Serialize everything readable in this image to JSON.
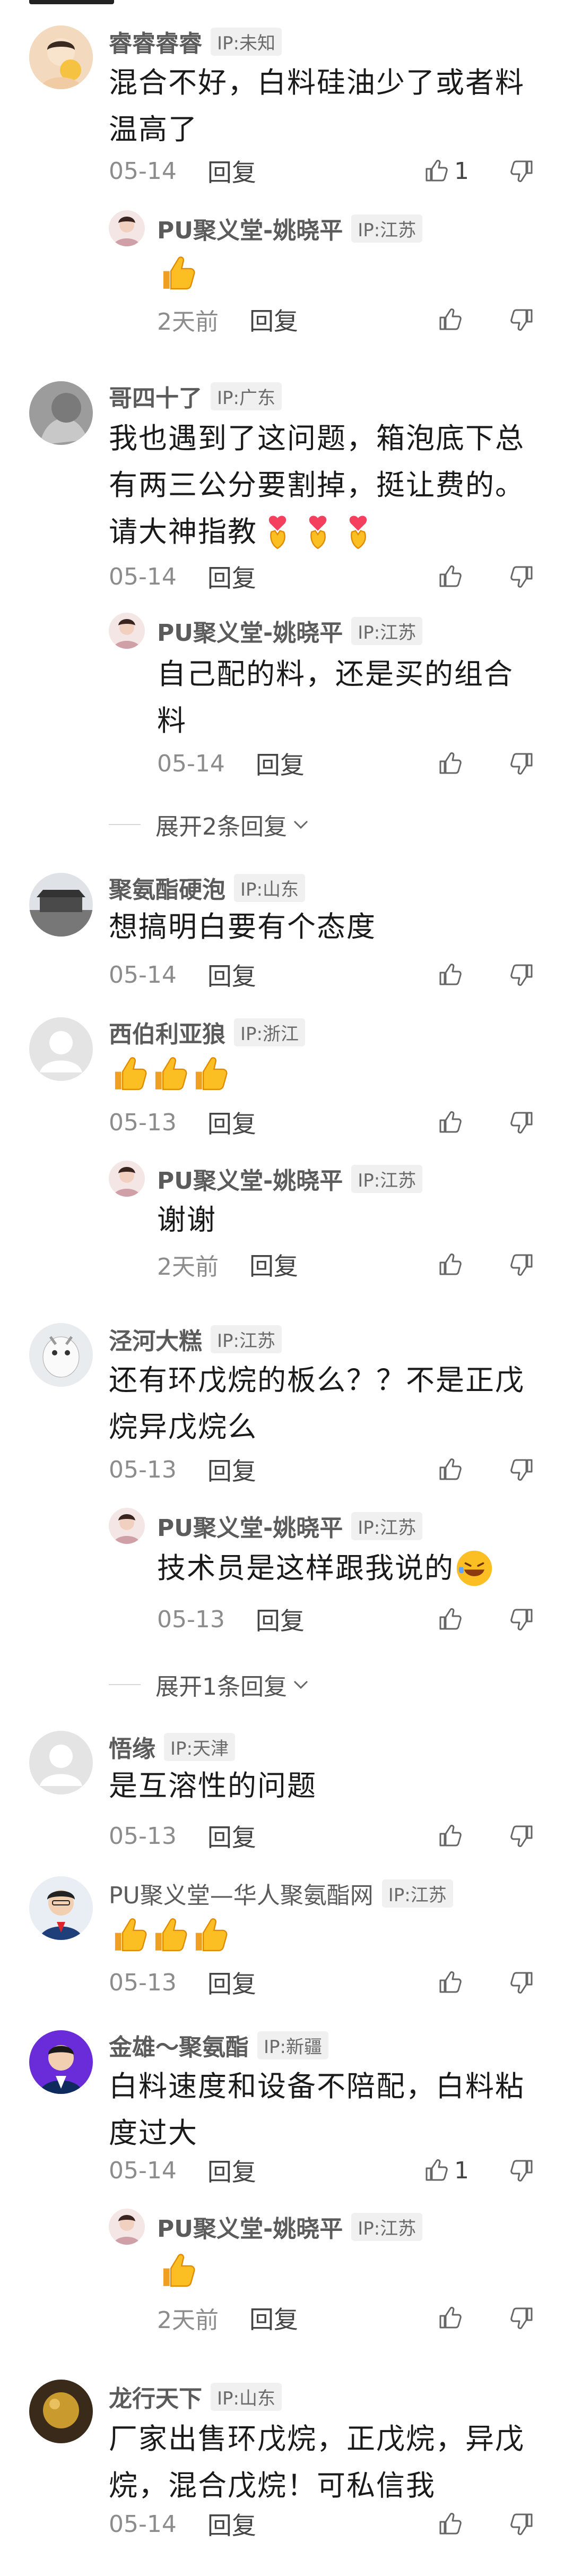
{
  "reply_label": "回复",
  "comments": [
    {
      "name": "睿睿睿睿",
      "ip": "IP:未知",
      "lines": [
        "混合不好，白料硅油少了或者料",
        "温高了"
      ],
      "date": "05-14",
      "likes": "1",
      "replies": [
        {
          "name": "PU聚义堂-姚晓平",
          "ip": "IP:江苏",
          "lines": [
            ""
          ],
          "emoji": "thumbs-up",
          "date": "2天前"
        }
      ]
    },
    {
      "name": "哥四十了",
      "ip": "IP:广东",
      "lines": [
        "我也遇到了这问题，箱泡底下总",
        "有两三公分要割掉，挺让费的。",
        "请大神指教"
      ],
      "date": "05-14",
      "likes": "",
      "replies": [
        {
          "name": "PU聚义堂-姚晓平",
          "ip": "IP:江苏",
          "lines": [
            "自己配的料，还是买的组合",
            "料"
          ],
          "date": "05-14"
        }
      ],
      "expand": "展开2条回复"
    },
    {
      "name": "聚氨酯硬泡",
      "ip": "IP:山东",
      "lines": [
        "想搞明白要有个态度"
      ],
      "date": "05-14",
      "likes": ""
    },
    {
      "name": "西伯利亚狼",
      "ip": "IP:浙江",
      "lines": [
        ""
      ],
      "date": "05-13",
      "likes": "",
      "replies": [
        {
          "name": "PU聚义堂-姚晓平",
          "ip": "IP:江苏",
          "lines": [
            "谢谢"
          ],
          "date": "2天前"
        }
      ]
    },
    {
      "name": "泾河大糕",
      "ip": "IP:江苏",
      "lines": [
        "还有环戊烷的板么？？不是正戊",
        "烷异戊烷么"
      ],
      "date": "05-13",
      "likes": "",
      "replies": [
        {
          "name": "PU聚义堂-姚晓平",
          "ip": "IP:江苏",
          "lines": [
            "技术员是这样跟我说的"
          ],
          "date": "05-13"
        }
      ],
      "expand": "展开1条回复"
    },
    {
      "name": "悟缘",
      "ip": "IP:天津",
      "lines": [
        "是互溶性的问题"
      ],
      "date": "05-13",
      "likes": ""
    },
    {
      "name": "PU聚义堂—华人聚氨酯网",
      "ip": "IP:江苏",
      "lines": [
        ""
      ],
      "date": "05-13",
      "likes": ""
    },
    {
      "name": "金雄～聚氨酯",
      "ip": "IP:新疆",
      "lines": [
        "白料速度和设备不陪配，白料粘",
        "度过大"
      ],
      "date": "05-14",
      "likes": "1",
      "replies": [
        {
          "name": "PU聚义堂-姚晓平",
          "ip": "IP:江苏",
          "lines": [
            ""
          ],
          "date": "2天前"
        }
      ]
    },
    {
      "name": "龙行天下",
      "ip": "IP:山东",
      "lines": [
        "厂家出售环戊烷，正戊烷，异戊",
        "烷，混合戊烷！可私信我"
      ],
      "date": "05-14",
      "likes": ""
    }
  ],
  "icons": {
    "like": "thumbs-up-outline-icon",
    "dislike": "thumbs-down-outline-icon",
    "expand": "chevron-down-icon"
  }
}
